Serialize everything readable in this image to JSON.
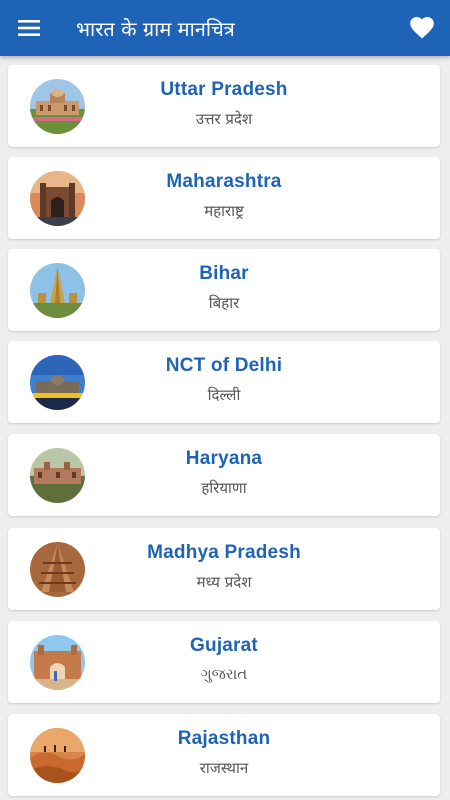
{
  "app_bar": {
    "title": "भारत के ग्राम मानचित्र",
    "menu_icon": "hamburger-menu-icon",
    "favorite_icon": "heart-icon"
  },
  "colors": {
    "primary": "#1f63b7",
    "background": "#eeeeee",
    "card": "#ffffff"
  },
  "states": [
    {
      "name_en": "Uttar Pradesh",
      "name_local": "उत्तर प्रदेश"
    },
    {
      "name_en": "Maharashtra",
      "name_local": "महाराष्ट्र"
    },
    {
      "name_en": "Bihar",
      "name_local": "बिहार"
    },
    {
      "name_en": "NCT of Delhi",
      "name_local": "दिल्ली"
    },
    {
      "name_en": "Haryana",
      "name_local": "हरियाणा"
    },
    {
      "name_en": "Madhya Pradesh",
      "name_local": "मध्य प्रदेश"
    },
    {
      "name_en": "Gujarat",
      "name_local": "ગુજરાત"
    },
    {
      "name_en": "Rajasthan",
      "name_local": "राजस्थान"
    }
  ]
}
